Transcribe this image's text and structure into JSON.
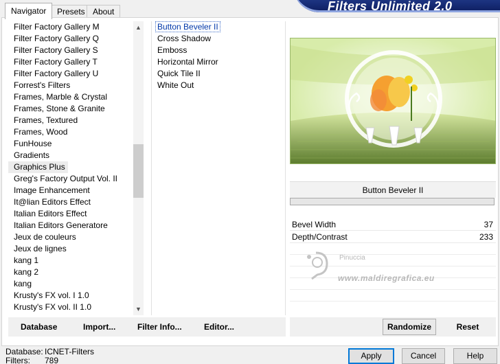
{
  "banner": {
    "title": "Filters Unlimited 2.0"
  },
  "tabs": [
    {
      "label": "Navigator"
    },
    {
      "label": "Presets"
    },
    {
      "label": "About"
    }
  ],
  "categories": [
    "Filter Factory Gallery M",
    "Filter Factory Gallery Q",
    "Filter Factory Gallery S",
    "Filter Factory Gallery T",
    "Filter Factory Gallery U",
    "Forrest's Filters",
    "Frames, Marble & Crystal",
    "Frames, Stone & Granite",
    "Frames, Textured",
    "Frames, Wood",
    "FunHouse",
    "Gradients",
    "Graphics Plus",
    "Greg's Factory Output Vol. II",
    "Image Enhancement",
    "It@lian Editors Effect",
    "Italian Editors Effect",
    "Italian Editors Generatore",
    "Jeux de couleurs",
    "Jeux de lignes",
    "kang 1",
    "kang 2",
    "kang",
    "Krusty's FX vol. I 1.0",
    "Krusty's FX vol. II 1.0"
  ],
  "selected_category_index": 12,
  "filters": [
    "Button Beveler II",
    "Cross Shadow",
    "Emboss",
    "Horizontal Mirror",
    "Quick Tile II",
    "White Out"
  ],
  "params": {
    "title": "Button Beveler II",
    "rows": [
      {
        "label": "Bevel Width",
        "value": "37"
      },
      {
        "label": "Depth/Contrast",
        "value": "233"
      }
    ]
  },
  "watermark": {
    "name": "Pinuccia",
    "site": "www.maldiregrafica.eu"
  },
  "toolbar": {
    "database": "Database",
    "import": "Import...",
    "filter_info": "Filter Info...",
    "editor": "Editor...",
    "randomize": "Randomize",
    "reset": "Reset"
  },
  "status": {
    "database_label": "Database:",
    "database_value": "ICNET-Filters",
    "filters_label": "Filters:",
    "filters_value": "789"
  },
  "buttons": {
    "apply": "Apply",
    "cancel": "Cancel",
    "help": "Help"
  },
  "icons": {
    "scroll_up": "chevron-up-icon",
    "scroll_down": "chevron-down-icon"
  },
  "colors": {
    "banner": "#1a2f7c",
    "selection": "#0037a8",
    "default_button_border": "#0078d7"
  }
}
